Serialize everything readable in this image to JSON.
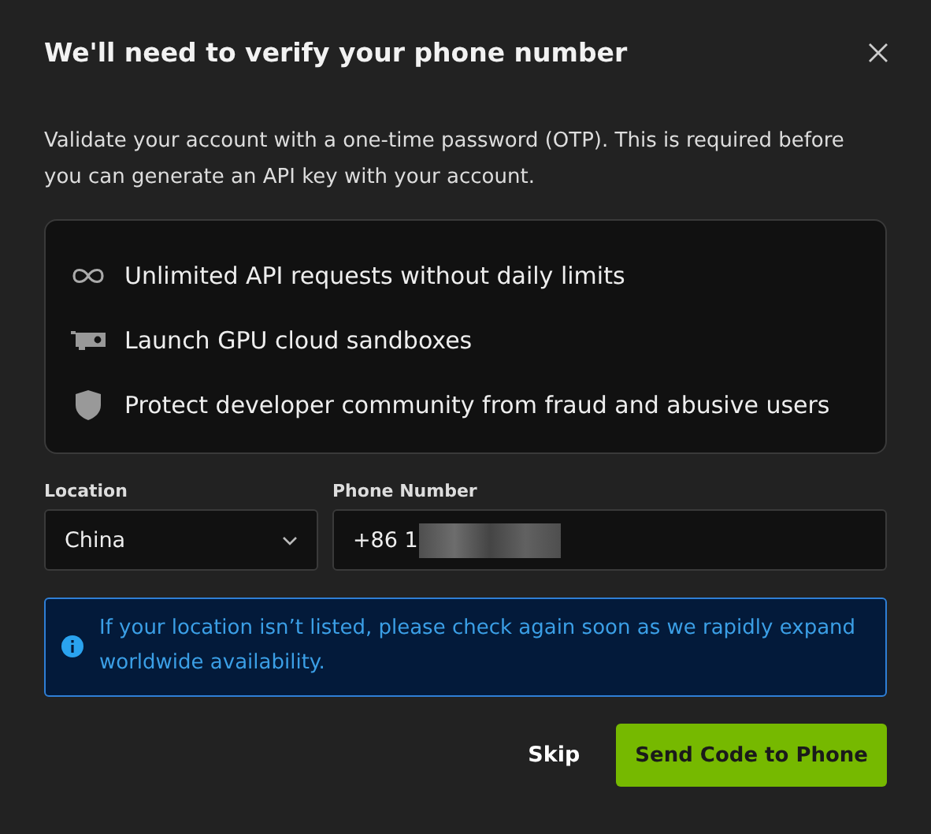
{
  "dialog": {
    "title": "We'll need to verify your phone number",
    "description": "Validate your account with a one-time password (OTP). This is required before you can generate an API key with your account."
  },
  "features": [
    {
      "kind": "infinity",
      "text": "Unlimited API requests without daily limits"
    },
    {
      "kind": "gpu",
      "text": "Launch GPU cloud sandboxes"
    },
    {
      "kind": "shield",
      "text": "Protect developer community from fraud and abusive users"
    }
  ],
  "location": {
    "label": "Location",
    "value": "China"
  },
  "phone": {
    "label": "Phone Number",
    "value": "+86 1",
    "redacted": true
  },
  "notice": {
    "text": "If your location isn’t listed, please check again soon as we rapidly expand worldwide availability."
  },
  "buttons": [
    {
      "kind": "text",
      "label": "Skip"
    },
    {
      "kind": "primary",
      "label": "Send Code to Phone"
    }
  ]
}
